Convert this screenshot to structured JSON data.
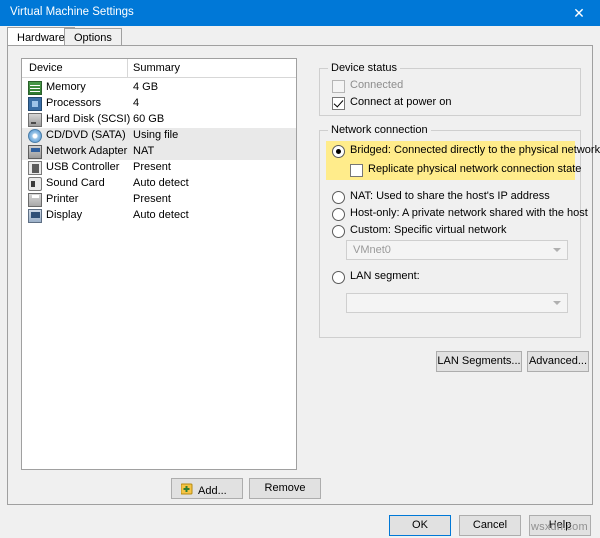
{
  "window": {
    "title": "Virtual Machine Settings",
    "close_label": "✕"
  },
  "tabs": [
    {
      "label": "Hardware",
      "active": true
    },
    {
      "label": "Options",
      "active": false
    }
  ],
  "device_list": {
    "columns": [
      "Device",
      "Summary"
    ],
    "rows": [
      {
        "name": "Memory",
        "summary": "4 GB",
        "icon": "memory-icon",
        "selected": false
      },
      {
        "name": "Processors",
        "summary": "4",
        "icon": "processor-icon",
        "selected": false
      },
      {
        "name": "Hard Disk (SCSI)",
        "summary": "60 GB",
        "icon": "harddisk-icon",
        "selected": false
      },
      {
        "name": "CD/DVD (SATA)",
        "summary": "Using file",
        "icon": "cddvd-icon",
        "selected": true
      },
      {
        "name": "Network Adapter",
        "summary": "NAT",
        "icon": "network-icon",
        "selected": true
      },
      {
        "name": "USB Controller",
        "summary": "Present",
        "icon": "usb-icon",
        "selected": false
      },
      {
        "name": "Sound Card",
        "summary": "Auto detect",
        "icon": "sound-icon",
        "selected": false
      },
      {
        "name": "Printer",
        "summary": "Present",
        "icon": "printer-icon",
        "selected": false
      },
      {
        "name": "Display",
        "summary": "Auto detect",
        "icon": "display-icon",
        "selected": false
      }
    ],
    "add_label": "Add...",
    "remove_label": "Remove"
  },
  "device_status": {
    "legend": "Device status",
    "connected": {
      "label": "Connected",
      "checked": false,
      "disabled": true
    },
    "connect_at_power_on": {
      "label": "Connect at power on",
      "checked": true,
      "disabled": false
    }
  },
  "network_connection": {
    "legend": "Network connection",
    "options": [
      {
        "label": "Bridged: Connected directly to the physical network",
        "selected": true,
        "disabled": false
      },
      {
        "label": "NAT: Used to share the host's IP address",
        "selected": false,
        "disabled": false
      },
      {
        "label": "Host-only: A private network shared with the host",
        "selected": false,
        "disabled": false
      },
      {
        "label": "Custom: Specific virtual network",
        "selected": false,
        "disabled": false
      },
      {
        "label": "LAN segment:",
        "selected": false,
        "disabled": false
      }
    ],
    "replicate": {
      "label": "Replicate physical network connection state",
      "checked": false
    },
    "custom_network_value": "VMnet0",
    "lan_segment_value": "",
    "highlight_color": "#ffec8b",
    "lan_segments_label": "LAN Segments...",
    "advanced_label": "Advanced..."
  },
  "footer": {
    "ok_label": "OK",
    "cancel_label": "Cancel",
    "help_label": "Help",
    "watermark": "wsxdn.com"
  }
}
